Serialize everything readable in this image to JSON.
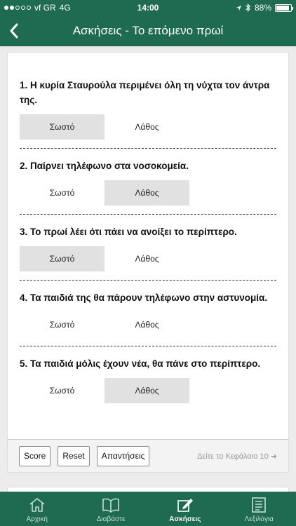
{
  "status": {
    "carrier": "vf GR",
    "network": "4G",
    "time": "14:00",
    "battery": "88%",
    "battery_level": 0.88
  },
  "nav": {
    "title": "Ασκήσεις - Το επόμενο πρωί",
    "back_icon": "chevron-left-icon"
  },
  "questions": [
    {
      "text": "1. Η κυρία Σταυρούλα περιμένει όλη τη νύχτα τον άντρα της.",
      "true_label": "Σωστό",
      "false_label": "Λάθος",
      "selected": "true"
    },
    {
      "text": "2. Παίρνει τηλέφωνο στα νοσοκομεία.",
      "true_label": "Σωστό",
      "false_label": "Λάθος",
      "selected": "false"
    },
    {
      "text": "3. Το πρωί λέει ότι πάει να ανοίξει το περίπτερο.",
      "true_label": "Σωστό",
      "false_label": "Λάθος",
      "selected": "true"
    },
    {
      "text": "4. Τα παιδιά της θα πάρουν τηλέφωνο στην αστυνομία.",
      "true_label": "Σωστό",
      "false_label": "Λάθος",
      "selected": "none"
    },
    {
      "text": "5. Τα παιδιά μόλις έχουν νέα, θα πάνε στο περίπτερο.",
      "true_label": "Σωστό",
      "false_label": "Λάθος",
      "selected": "false"
    }
  ],
  "toolbar": {
    "score_label": "Score",
    "reset_label": "Reset",
    "answers_label": "Απαντήσεις",
    "next_chapter_label": "Δείτε το Κεφάλαιο 10 ➜"
  },
  "tabs": [
    {
      "label": "Αρχική",
      "icon": "home-icon",
      "active": false
    },
    {
      "label": "Διαβάστε",
      "icon": "book-icon",
      "active": false
    },
    {
      "label": "Ασκήσεις",
      "icon": "edit-icon",
      "active": true
    },
    {
      "label": "Λεξιλόγια",
      "icon": "list-icon",
      "active": false
    }
  ],
  "colors": {
    "brand": "#1e6b52",
    "selected_answer": "#e1e1e1"
  }
}
